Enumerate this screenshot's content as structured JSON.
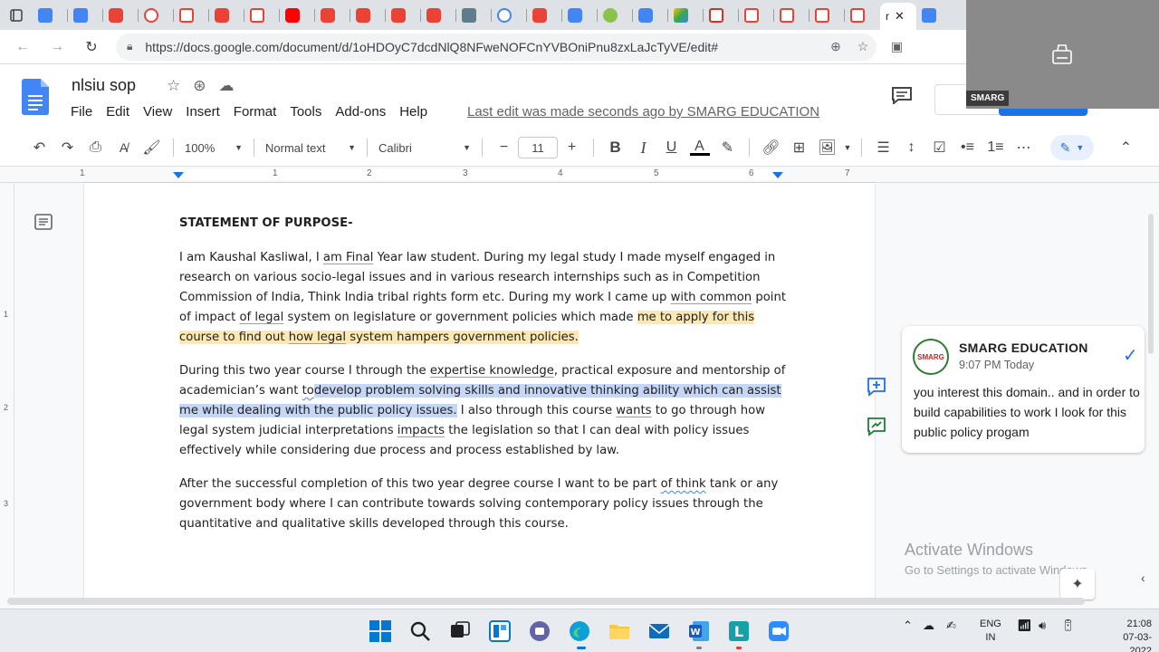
{
  "browser": {
    "active_tab_label": "r",
    "url": "https://docs.google.com/document/d/1oHDOyC7dcdNlQ8NFweNOFCnYVBOniPnu8zxLaJcTyVE/edit#"
  },
  "overlay": {
    "tag": "SMARG"
  },
  "docs": {
    "title": "nlsiu sop",
    "menu": [
      "File",
      "Edit",
      "View",
      "Insert",
      "Format",
      "Tools",
      "Add-ons",
      "Help"
    ],
    "last_edit": "Last edit was made seconds ago by SMARG EDUCATION"
  },
  "toolbar": {
    "zoom": "100%",
    "style": "Normal text",
    "font": "Calibri",
    "font_size": "11",
    "minus": "−",
    "plus": "+",
    "bold": "B",
    "italic": "I",
    "underline": "U",
    "text_color_glyph": "A"
  },
  "ruler": {
    "numbers": [
      "1",
      "1",
      "2",
      "3",
      "4",
      "5",
      "6",
      "7"
    ]
  },
  "vruler": {
    "numbers": [
      "1",
      "2",
      "3"
    ]
  },
  "document": {
    "heading": "STATEMENT OF PURPOSE-",
    "p1_a": "I am Kaushal Kasliwal, I ",
    "p1_am_final": "am Final",
    "p1_b": " Year law student. During my legal study I made myself engaged in research on various socio-legal issues and in various research internships such as in Competition Commission of India, Think India tribal rights form etc. During my work I came up ",
    "p1_with_common": "with common",
    "p1_c": " point of impact ",
    "p1_of_legal": "of legal",
    "p1_d": " system on legislature or government policies which made ",
    "p1_hl1": "me to apply for this course to find out ",
    "p1_hl_how_legal": "how legal",
    "p1_hl2": " system hampers government policies.",
    "p2_a": "During this two year course I through the ",
    "p2_expertise": "expertise knowledge",
    "p2_b": ", practical exposure and mentorship of academician’s want ",
    "p2_to": "to",
    "p2_sel": "develop problem solving skills and innovative thinking ability which can assist me while dealing with the public policy issues.",
    "p2_c": " I also through this course ",
    "p2_wants": "wants",
    "p2_d": " to go through how legal system judicial interpretations ",
    "p2_impacts": "impacts",
    "p2_e": " the legislation so that I can deal with policy issues effectively while considering due process and process established by law.",
    "p3_a": "After the successful completion of this two year degree course I want to be part ",
    "p3_of_think": "of think",
    "p3_b": " tank or any government body where I can contribute towards solving contemporary policy issues through the quantitative and qualitative skills developed through this course."
  },
  "comment": {
    "author": "SMARG EDUCATION",
    "time": "9:07 PM Today",
    "avatar_text": "SMARG",
    "body": "you interest this domain.. and in order to build capabilities to work I look for this public policy progam"
  },
  "watermark": {
    "line1": "Activate Windows",
    "line2": "Go to Settings to activate Windows."
  },
  "tray": {
    "lang1": "ENG",
    "lang2": "IN",
    "time": "21:08",
    "date": "07-03-2022"
  },
  "colors": {
    "docs_blue": "#4285f4",
    "accent": "#1a73e8",
    "highlight_yellow": "#fce8b2",
    "selection_blue": "#c6d6f5"
  }
}
